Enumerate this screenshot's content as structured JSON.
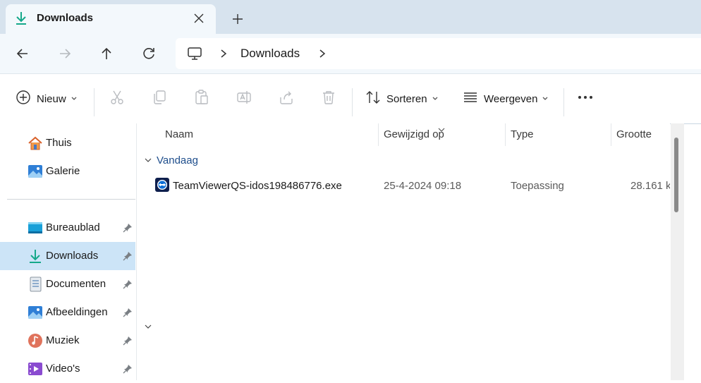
{
  "tab": {
    "title": "Downloads",
    "icon": "download-icon"
  },
  "address": {
    "crumbs": [
      "Downloads"
    ],
    "root_icon": "this-pc-icon"
  },
  "toolbar": {
    "new_label": "Nieuw",
    "sort_label": "Sorteren",
    "view_label": "Weergeven",
    "icons": [
      "cut-icon",
      "copy-icon",
      "paste-icon",
      "rename-icon",
      "share-icon",
      "delete-icon",
      "more-icon"
    ]
  },
  "sidebar": {
    "top_items": [
      {
        "label": "Thuis",
        "icon": "home-icon"
      },
      {
        "label": "Galerie",
        "icon": "gallery-icon"
      }
    ],
    "pinned_items": [
      {
        "label": "Bureaublad",
        "icon": "desktop-icon"
      },
      {
        "label": "Downloads",
        "icon": "download-icon",
        "selected": true
      },
      {
        "label": "Documenten",
        "icon": "documents-icon"
      },
      {
        "label": "Afbeeldingen",
        "icon": "pictures-icon"
      },
      {
        "label": "Muziek",
        "icon": "music-icon"
      },
      {
        "label": "Video's",
        "icon": "videos-icon"
      }
    ]
  },
  "columns": {
    "name": "Naam",
    "modified": "Gewijzigd op",
    "type": "Type",
    "size": "Grootte"
  },
  "groups": [
    {
      "label": "Vandaag",
      "files": [
        {
          "name": "TeamViewerQS-idos198486776.exe",
          "modified": "25-4-2024 09:18",
          "type": "Toepassing",
          "size": "28.161 k",
          "icon": "teamviewer-icon"
        }
      ]
    }
  ],
  "colors": {
    "accent": "#0067c0",
    "selected": "#cce4f7",
    "group_header": "#1e4e8c",
    "tabbar": "#d7e3ee"
  }
}
